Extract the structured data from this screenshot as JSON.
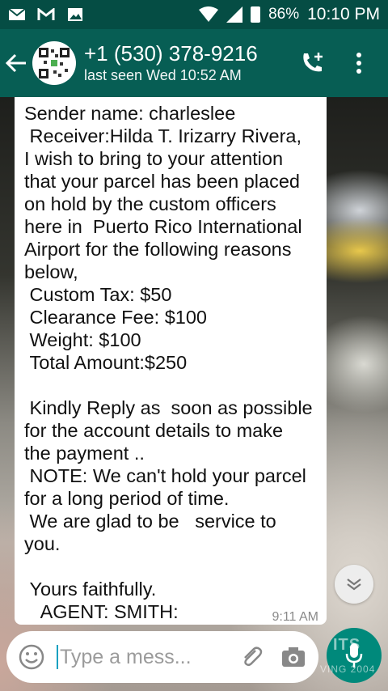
{
  "status_bar": {
    "battery": "86%",
    "time": "10:10 PM",
    "icons": [
      "email-icon",
      "gmail-icon",
      "gallery-icon",
      "wifi-icon",
      "signal-icon",
      "battery-icon"
    ]
  },
  "header": {
    "contact_number": "+1 (530) 378-9216",
    "last_seen": "last seen Wed 10:52 AM",
    "icons": [
      "back-arrow-icon",
      "qr-avatar",
      "add-call-icon",
      "more-vert-icon"
    ]
  },
  "message": {
    "lines": [
      "Sender name: charleslee",
      " Receiver:Hilda T. Irizarry Rivera,",
      "I wish to bring to your attention",
      "that your parcel has been placed",
      "on hold by the custom officers",
      "here in  Puerto Rico International",
      "Airport for the following reasons",
      "below,",
      " Custom Tax: $50",
      " Clearance Fee: $100",
      " Weight: $100",
      " Total Amount:$250",
      "",
      " Kindly Reply as  soon as possible",
      "for the account details to make",
      "the payment ..",
      " NOTE: We can't hold your parcel",
      "for a long period of time.",
      " We are glad to be   service to",
      "you.",
      "",
      " Yours faithfully.",
      "   AGENT: SMITH:"
    ],
    "time": "9:11 AM"
  },
  "input": {
    "placeholder": "Type a mess..."
  },
  "watermark": {
    "text": "ITS",
    "subtext": "VING 2004"
  },
  "colors": {
    "status_bar": "#054d44",
    "app_bar": "#075e54",
    "mic_button": "#00897b",
    "bubble": "#ffffff"
  }
}
